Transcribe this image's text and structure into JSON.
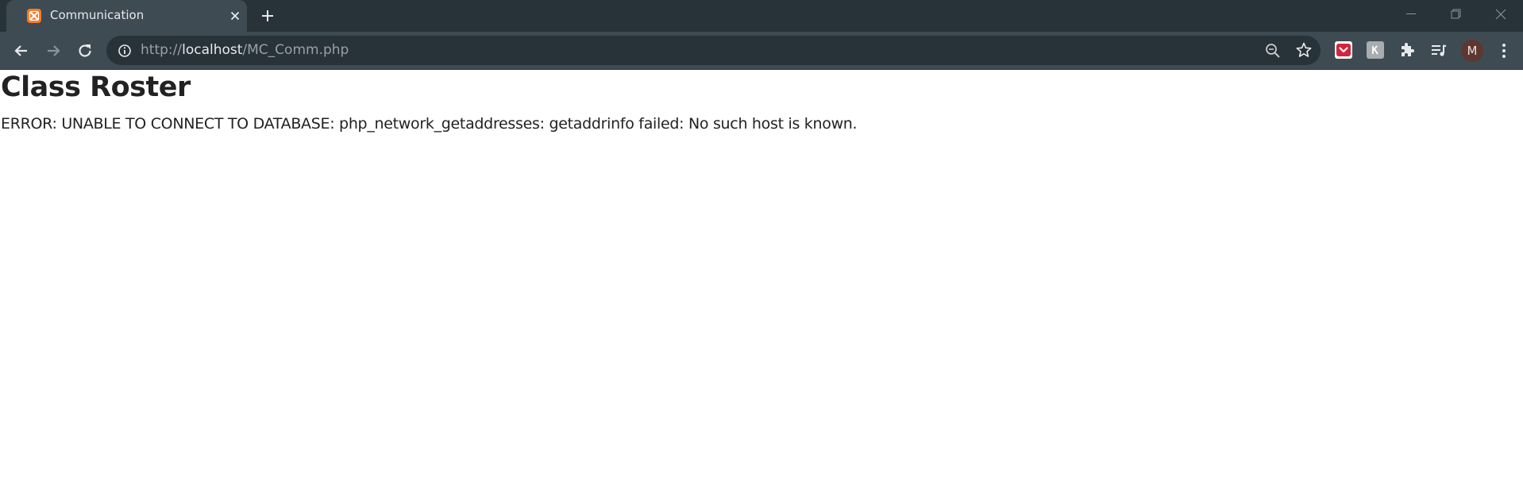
{
  "browser": {
    "tab": {
      "title": "Communication",
      "favicon": "xampp-icon"
    },
    "address_bar": {
      "scheme": "http://",
      "host": "localhost",
      "path": "/MC_Comm.php"
    },
    "profile_initial": "M",
    "colors": {
      "frame": "#283239",
      "toolbar": "#3e4b53",
      "favicon": "#fb7a24",
      "avatar": "#5d3731"
    }
  },
  "page": {
    "title": "Class Roster",
    "error": "ERROR: UNABLE TO CONNECT TO DATABASE: php_network_getaddresses: getaddrinfo failed: No such host is known."
  }
}
